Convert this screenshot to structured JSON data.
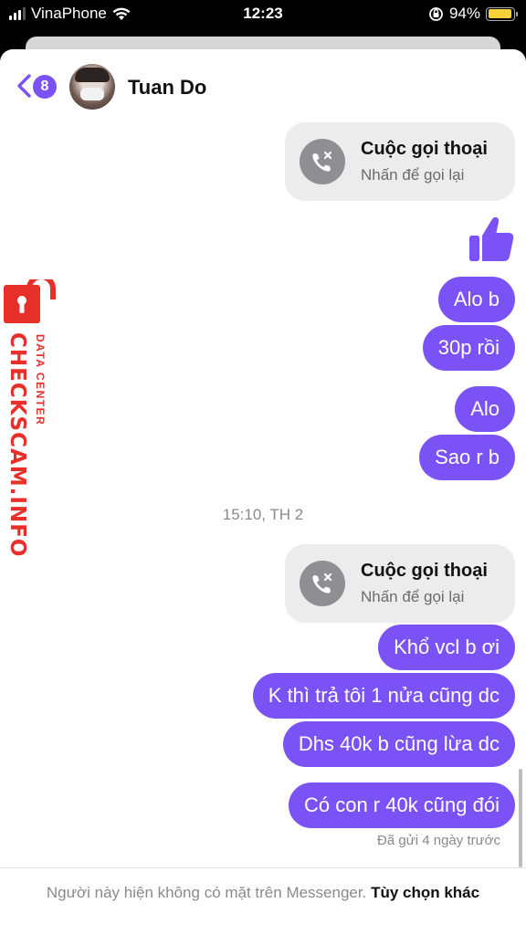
{
  "status_bar": {
    "carrier": "VinaPhone",
    "time": "12:23",
    "battery": "94%",
    "battery_level": 0.94,
    "battery_color": "#f5d23a"
  },
  "header": {
    "unread_count": "8",
    "contact_name": "Tuan Do",
    "accent_color": "#7b52f5"
  },
  "messages": {
    "call_1": {
      "title": "Cuộc gọi thoại",
      "subtitle": "Nhấn để gọi lại"
    },
    "like_icon": "thumbs-up-icon",
    "out_1": "Alo b",
    "out_2": "30p rồi",
    "out_3": "Alo",
    "out_4": "Sao r b",
    "timestamp": "15:10, TH 2",
    "call_2": {
      "title": "Cuộc gọi thoại",
      "subtitle": "Nhấn để gọi lại"
    },
    "out_5": "Khổ vcl b ơi",
    "out_6": "K thì trả tôi 1 nửa cũng dc",
    "out_7": "Dhs 40k b cũng lừa dc",
    "out_8": "Có con r 40k cũng đói",
    "seen_status": "Đã gửi 4 ngày trước"
  },
  "watermark": {
    "main": "CHECKSCAM.INFO",
    "sub": "DATA CENTER",
    "color": "#e8302a"
  },
  "footer": {
    "notice": "Người này hiện không có mặt trên Messenger.",
    "options_link": "Tùy chọn khác"
  }
}
